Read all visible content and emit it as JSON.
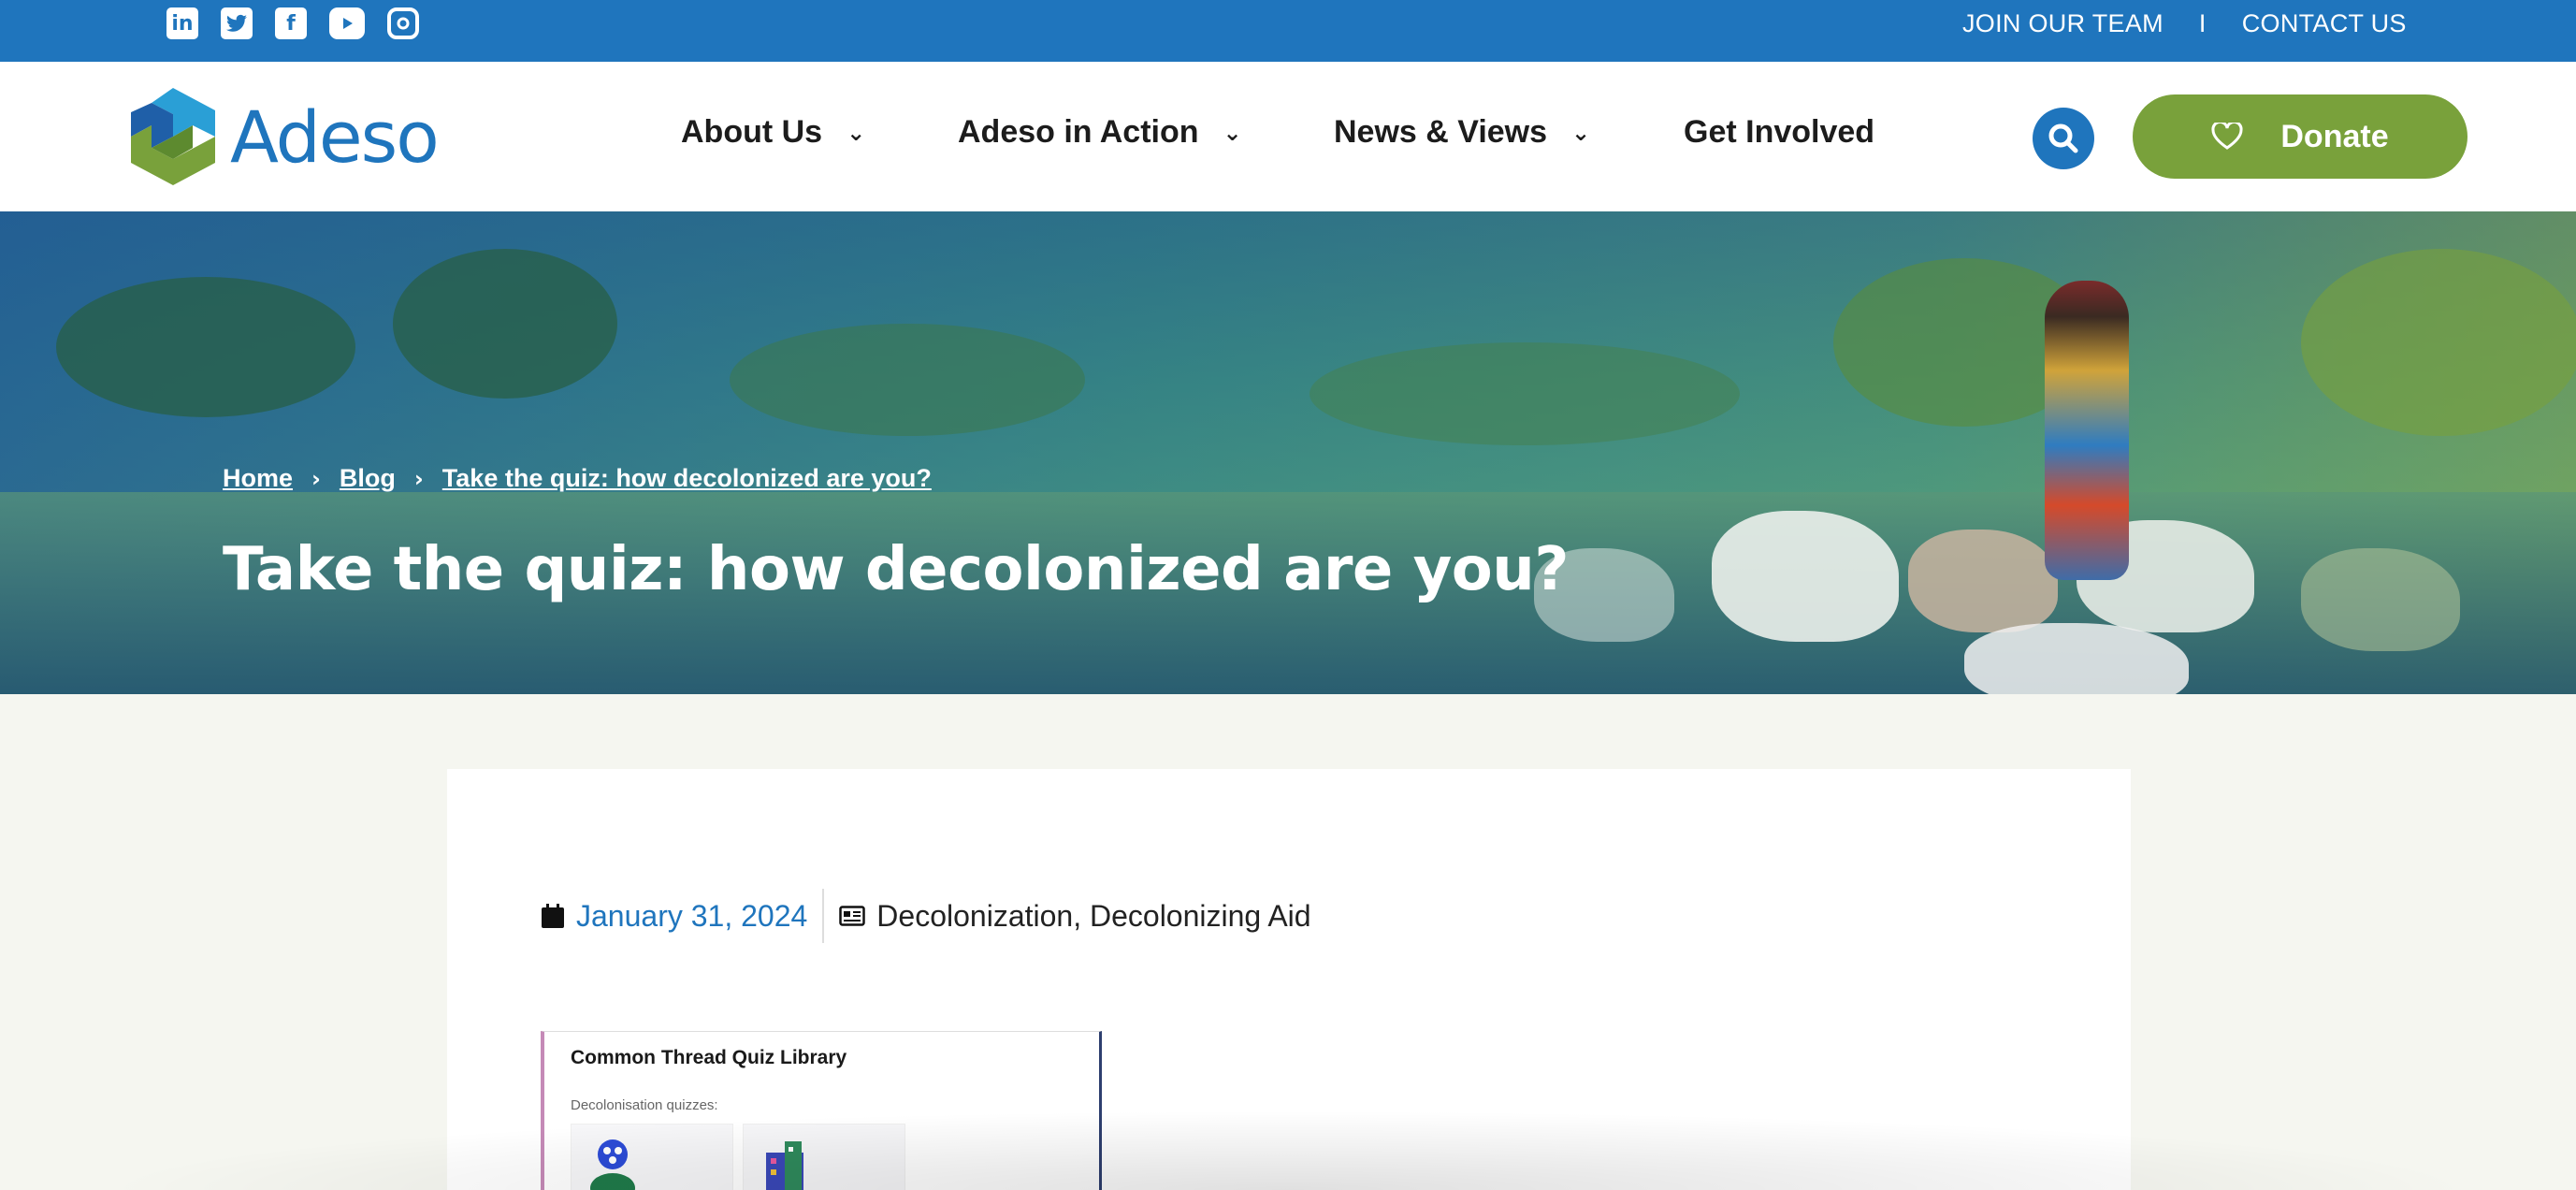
{
  "top_bar": {
    "social_icons": [
      "linkedin-icon",
      "twitter-icon",
      "facebook-icon",
      "youtube-icon",
      "instagram-icon"
    ],
    "join_team": "JOIN OUR TEAM",
    "separator": "I",
    "contact": "CONTACT US"
  },
  "header": {
    "logo_text": "Adeso",
    "nav": [
      {
        "label": "About Us",
        "has_dropdown": true
      },
      {
        "label": "Adeso in Action",
        "has_dropdown": true
      },
      {
        "label": "News & Views",
        "has_dropdown": true
      },
      {
        "label": "Get Involved",
        "has_dropdown": false
      }
    ],
    "search_icon": "search-icon",
    "donate_label": "Donate",
    "donate_icon": "heart-icon"
  },
  "hero": {
    "breadcrumb": [
      "Home",
      "Blog",
      "Take the quiz: how decolonized are you?"
    ],
    "title": "Take the quiz: how decolonized are you?"
  },
  "post": {
    "date": "January 31, 2024",
    "categories": "Decolonization, Decolonizing Aid",
    "thumbnail_title": "Common Thread Quiz Library",
    "thumbnail_subtitle": "Decolonisation quizzes:"
  },
  "colors": {
    "brand_blue": "#1f75bd",
    "donate_green": "#79a13b",
    "page_bg": "#f5f6f0"
  }
}
